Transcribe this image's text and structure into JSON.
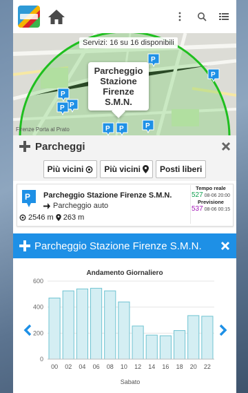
{
  "topbar": {
    "logo_icon": "smart-city-logo-icon",
    "home_icon": "home-icon",
    "menu_icon": "kebab-menu-icon",
    "search_icon": "search-icon",
    "list_icon": "list-icon"
  },
  "map": {
    "services_label": "Servizi: 16 su 16 disponibili",
    "popup_line1": "Parcheggio",
    "popup_line2": "Stazione",
    "popup_line3": "Firenze",
    "popup_line4": "S.M.N.",
    "caption": "Firenze Porta al Prato",
    "marker_label": "P",
    "circle_color": "#1fbf1f",
    "marker_color": "#1e90e6"
  },
  "parcheggi": {
    "title": "Parcheggi",
    "filters": [
      "Più vicini",
      "Più vicini",
      "Posti liberi"
    ],
    "filter_icons": [
      "target-icon",
      "map-pin-icon",
      ""
    ]
  },
  "result": {
    "name": "Parcheggio Stazione Firenze S.M.N.",
    "type": "Parcheggio auto",
    "distance1": "2546 m",
    "distance2": "263 m",
    "realtime_label": "Tempo reale",
    "realtime_value": "527",
    "realtime_time": "08-06 20:00",
    "forecast_label": "Previsione",
    "forecast_value": "537",
    "forecast_time": "08-06 00:15"
  },
  "detail": {
    "title": "Parcheggio Stazione Firenze S.M.N.",
    "accent": "#1e90e6"
  },
  "chart_data": {
    "type": "bar",
    "title": "Andamento Giornaliero",
    "xlabel": "Sabato",
    "ylabel": "",
    "ylim": [
      0,
      600
    ],
    "yticks": [
      0,
      200,
      400,
      600
    ],
    "categories": [
      "00",
      "02",
      "04",
      "06",
      "08",
      "10",
      "12",
      "14",
      "16",
      "18",
      "20",
      "22"
    ],
    "values": [
      470,
      525,
      540,
      545,
      525,
      440,
      255,
      185,
      180,
      220,
      335,
      330
    ],
    "bar_color": "#d4eef3",
    "bar_border": "#6fc3d1"
  }
}
